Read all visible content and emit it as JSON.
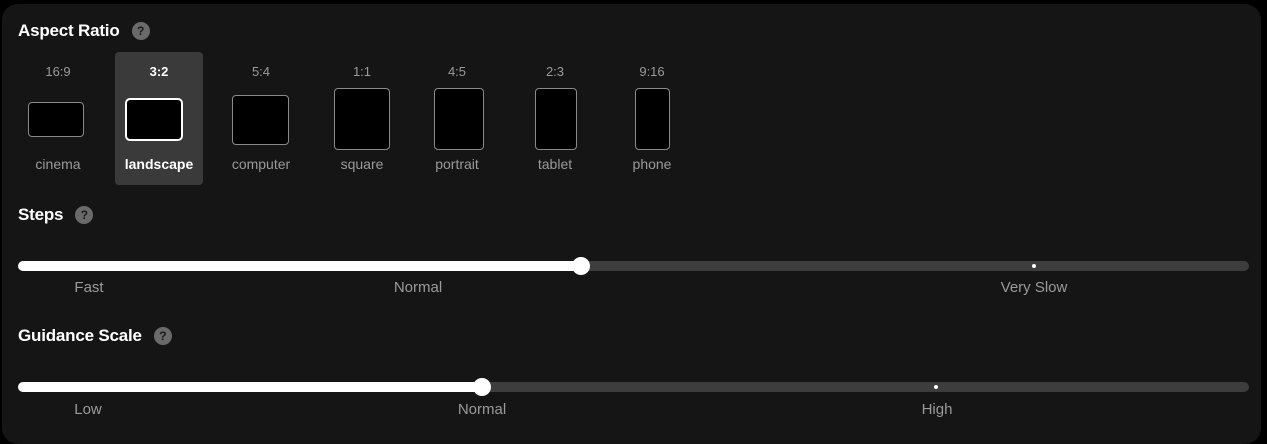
{
  "aspect_ratio": {
    "title": "Aspect Ratio",
    "help": "?",
    "selected": "3:2",
    "options": [
      {
        "ratio": "16:9",
        "name": "cinema"
      },
      {
        "ratio": "3:2",
        "name": "landscape"
      },
      {
        "ratio": "5:4",
        "name": "computer"
      },
      {
        "ratio": "1:1",
        "name": "square"
      },
      {
        "ratio": "4:5",
        "name": "portrait"
      },
      {
        "ratio": "2:3",
        "name": "tablet"
      },
      {
        "ratio": "9:16",
        "name": "phone"
      }
    ]
  },
  "steps": {
    "title": "Steps",
    "help": "?",
    "value_fraction": 0.457,
    "labels": [
      "Fast",
      "Normal",
      "Very Slow"
    ]
  },
  "guidance_scale": {
    "title": "Guidance Scale",
    "help": "?",
    "value_fraction": 0.377,
    "labels": [
      "Low",
      "Normal",
      "High"
    ]
  },
  "colors": {
    "panel_bg": "#151515",
    "selected_bg": "#3a3a3a",
    "track": "#3d3d3d",
    "fill": "#ffffff",
    "muted_text": "#9a9a9a"
  }
}
